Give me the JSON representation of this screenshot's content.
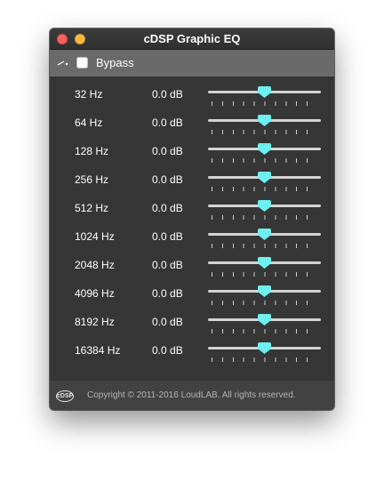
{
  "window": {
    "title": "cDSP Graphic EQ"
  },
  "bypass": {
    "label": "Bypass",
    "checked": false
  },
  "bands": [
    {
      "frequency": "32 Hz",
      "gain": "0.0 dB",
      "level": 0.5
    },
    {
      "frequency": "64 Hz",
      "gain": "0.0 dB",
      "level": 0.5
    },
    {
      "frequency": "128 Hz",
      "gain": "0.0 dB",
      "level": 0.5
    },
    {
      "frequency": "256 Hz",
      "gain": "0.0 dB",
      "level": 0.5
    },
    {
      "frequency": "512 Hz",
      "gain": "0.0 dB",
      "level": 0.5
    },
    {
      "frequency": "1024 Hz",
      "gain": "0.0 dB",
      "level": 0.5
    },
    {
      "frequency": "2048 Hz",
      "gain": "0.0 dB",
      "level": 0.5
    },
    {
      "frequency": "4096 Hz",
      "gain": "0.0 dB",
      "level": 0.5
    },
    {
      "frequency": "8192 Hz",
      "gain": "0.0 dB",
      "level": 0.5
    },
    {
      "frequency": "16384 Hz",
      "gain": "0.0 dB",
      "level": 0.5
    }
  ],
  "footer": {
    "logo_text": "cDSP",
    "copyright": "Copyright © 2011-2016 LoudLAB. All rights reserved."
  },
  "colors": {
    "thumb": "#6df0ef",
    "bypass_bar": "#6a6a6a",
    "background": "#363636"
  },
  "icons": {
    "close": "close-icon",
    "minimize": "minimize-icon",
    "switch": "switch-icon",
    "logo": "cdsp-logo-icon"
  }
}
